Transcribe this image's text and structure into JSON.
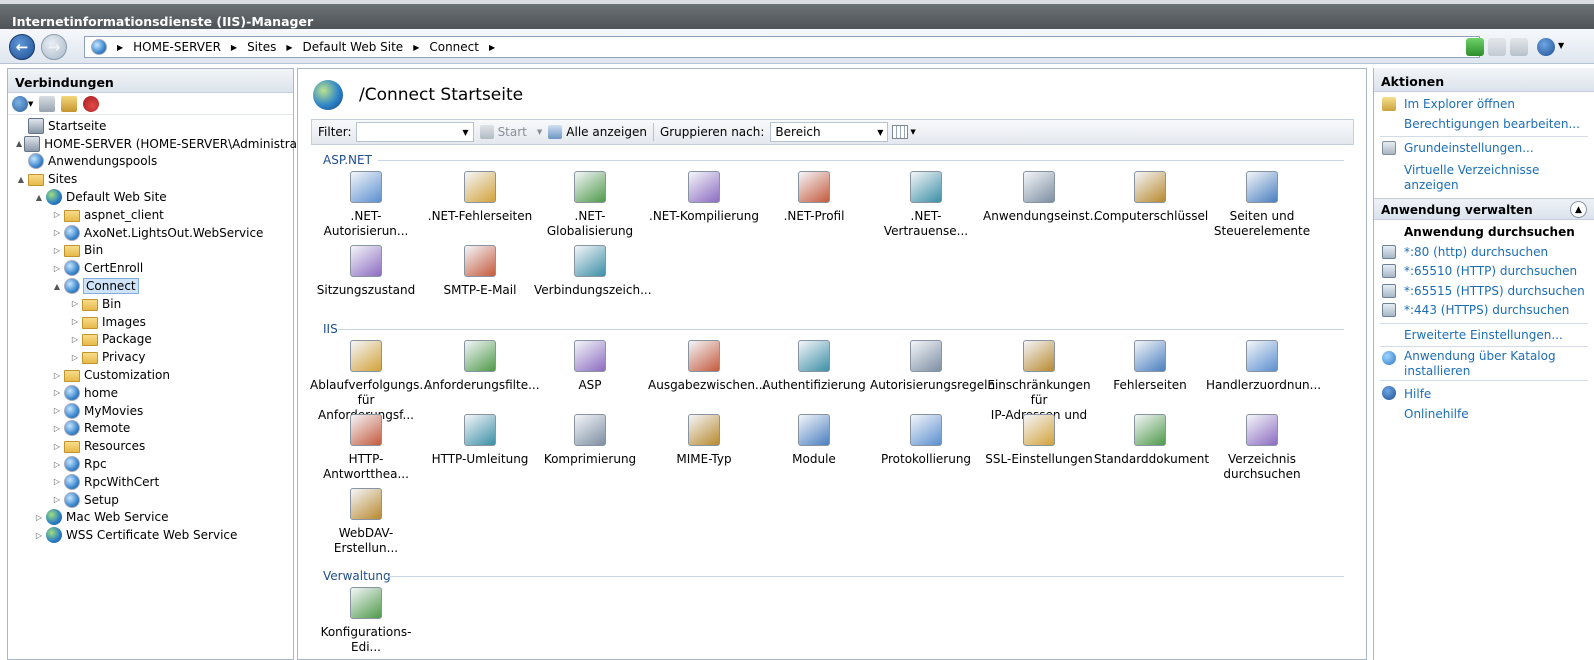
{
  "window": {
    "title": "Internetinformationsdienste (IIS)-Manager"
  },
  "address": {
    "crumbs": [
      "HOME-SERVER",
      "Sites",
      "Default Web Site",
      "Connect"
    ]
  },
  "connections": {
    "title": "Verbindungen",
    "tree": [
      {
        "label": "Startseite",
        "icon": "home-icon",
        "level": 0,
        "exp": ""
      },
      {
        "label": "HOME-SERVER (HOME-SERVER\\Administrator)",
        "icon": "server-icon",
        "level": 0,
        "exp": "▲"
      },
      {
        "label": "Anwendungspools",
        "icon": "app-pool-icon",
        "level": 1,
        "exp": ""
      },
      {
        "label": "Sites",
        "icon": "sites-icon",
        "level": 1,
        "exp": "▲"
      },
      {
        "label": "Default Web Site",
        "icon": "website-icon",
        "level": 2,
        "exp": "▲"
      },
      {
        "label": "aspnet_client",
        "icon": "folder-icon",
        "level": 3,
        "exp": "▷"
      },
      {
        "label": "AxoNet.LightsOut.WebService",
        "icon": "application-icon",
        "level": 3,
        "exp": "▷"
      },
      {
        "label": "Bin",
        "icon": "folder-icon",
        "level": 3,
        "exp": "▷"
      },
      {
        "label": "CertEnroll",
        "icon": "application-icon",
        "level": 3,
        "exp": "▷"
      },
      {
        "label": "Connect",
        "icon": "application-icon",
        "level": 3,
        "exp": "▲",
        "selected": true
      },
      {
        "label": "Bin",
        "icon": "folder-icon",
        "level": 4,
        "exp": "▷"
      },
      {
        "label": "Images",
        "icon": "folder-icon",
        "level": 4,
        "exp": "▷"
      },
      {
        "label": "Package",
        "icon": "folder-icon",
        "level": 4,
        "exp": "▷"
      },
      {
        "label": "Privacy",
        "icon": "folder-icon",
        "level": 4,
        "exp": "▷"
      },
      {
        "label": "Customization",
        "icon": "folder-icon",
        "level": 3,
        "exp": "▷"
      },
      {
        "label": "home",
        "icon": "application-icon",
        "level": 3,
        "exp": "▷"
      },
      {
        "label": "MyMovies",
        "icon": "application-icon",
        "level": 3,
        "exp": "▷"
      },
      {
        "label": "Remote",
        "icon": "application-icon",
        "level": 3,
        "exp": "▷"
      },
      {
        "label": "Resources",
        "icon": "folder-icon",
        "level": 3,
        "exp": "▷"
      },
      {
        "label": "Rpc",
        "icon": "application-icon",
        "level": 3,
        "exp": "▷"
      },
      {
        "label": "RpcWithCert",
        "icon": "application-icon",
        "level": 3,
        "exp": "▷"
      },
      {
        "label": "Setup",
        "icon": "application-icon",
        "level": 3,
        "exp": "▷"
      },
      {
        "label": "Mac Web Service",
        "icon": "website-icon",
        "level": 2,
        "exp": "▷"
      },
      {
        "label": "WSS Certificate Web Service",
        "icon": "website-icon",
        "level": 2,
        "exp": "▷"
      }
    ]
  },
  "center": {
    "title": "/Connect Startseite",
    "filter_label": "Filter:",
    "start_label": "Start",
    "show_all_label": "Alle anzeigen",
    "group_by_label": "Gruppieren nach:",
    "group_by_value": "Bereich",
    "groups": [
      {
        "name": "ASP.NET",
        "rows": [
          [
            {
              "label": ".NET-Autorisierun...",
              "icon": "net-authorization-icon"
            },
            {
              "label": ".NET-Fehlerseiten",
              "icon": "net-error-pages-icon"
            },
            {
              "label": ".NET-Globalisierung",
              "icon": "net-globalization-icon"
            },
            {
              "label": ".NET-Kompilierung",
              "icon": "net-compilation-icon"
            },
            {
              "label": ".NET-Profil",
              "icon": "net-profile-icon"
            },
            {
              "label": ".NET-Vertrauense...",
              "icon": "net-trust-icon"
            },
            {
              "label": "Anwendungseinst...",
              "icon": "app-settings-icon"
            },
            {
              "label": "Computerschlüssel",
              "icon": "machine-key-icon"
            },
            {
              "label": "Seiten und\nSteuerelemente",
              "icon": "pages-controls-icon"
            }
          ],
          [
            {
              "label": "Sitzungszustand",
              "icon": "session-state-icon"
            },
            {
              "label": "SMTP-E-Mail",
              "icon": "smtp-mail-icon"
            },
            {
              "label": "Verbindungszeich...",
              "icon": "connection-strings-icon"
            }
          ]
        ]
      },
      {
        "name": "IIS",
        "rows": [
          [
            {
              "label": "Ablaufverfolgungs...\nfür Anforderungsf...",
              "icon": "failed-request-tracing-icon"
            },
            {
              "label": "Anforderungsfilte...",
              "icon": "request-filtering-icon"
            },
            {
              "label": "ASP",
              "icon": "asp-icon"
            },
            {
              "label": "Ausgabezwischen...",
              "icon": "output-caching-icon"
            },
            {
              "label": "Authentifizierung",
              "icon": "authentication-icon"
            },
            {
              "label": "Autorisierungsregeln",
              "icon": "authorization-rules-icon"
            },
            {
              "label": "Einschränkungen für\nIP-Adressen und D...",
              "icon": "ip-restrictions-icon"
            },
            {
              "label": "Fehlerseiten",
              "icon": "error-pages-icon"
            },
            {
              "label": "Handlerzuordnun...",
              "icon": "handler-mappings-icon"
            }
          ],
          [
            {
              "label": "HTTP-Antwortthea...",
              "icon": "http-response-headers-icon"
            },
            {
              "label": "HTTP-Umleitung",
              "icon": "http-redirect-icon"
            },
            {
              "label": "Komprimierung",
              "icon": "compression-icon"
            },
            {
              "label": "MIME-Typ",
              "icon": "mime-types-icon"
            },
            {
              "label": "Module",
              "icon": "modules-icon"
            },
            {
              "label": "Protokollierung",
              "icon": "logging-icon"
            },
            {
              "label": "SSL-Einstellungen",
              "icon": "ssl-settings-icon"
            },
            {
              "label": "Standarddokument",
              "icon": "default-document-icon"
            },
            {
              "label": "Verzeichnis\ndurchsuchen",
              "icon": "directory-browsing-icon"
            }
          ],
          [
            {
              "label": "WebDAV-Erstellun...",
              "icon": "webdav-icon"
            }
          ]
        ]
      },
      {
        "name": "Verwaltung",
        "rows": [
          [
            {
              "label": "Konfigurations-Edi...",
              "icon": "configuration-editor-icon"
            }
          ]
        ]
      }
    ]
  },
  "actions": {
    "title": "Aktionen",
    "items1": [
      {
        "label": "Im Explorer öffnen",
        "icon": "explore-icon"
      },
      {
        "label": "Berechtigungen bearbeiten...",
        "icon": ""
      }
    ],
    "items2": [
      {
        "label": "Grundeinstellungen...",
        "icon": "basic-settings-icon"
      },
      {
        "label": "Virtuelle Verzeichnisse\nanzeigen",
        "icon": ""
      }
    ],
    "manage_title": "Anwendung verwalten",
    "browse_title": "Anwendung durchsuchen",
    "browse": [
      "*:80 (http) durchsuchen",
      "*:65510 (HTTP) durchsuchen",
      "*:65515 (HTTPS) durchsuchen",
      "*:443 (HTTPS) durchsuchen"
    ],
    "advanced": "Erweiterte Einstellungen...",
    "install_catalog": "Anwendung über Katalog\ninstallieren",
    "help": "Hilfe",
    "online_help": "Onlinehilfe"
  }
}
